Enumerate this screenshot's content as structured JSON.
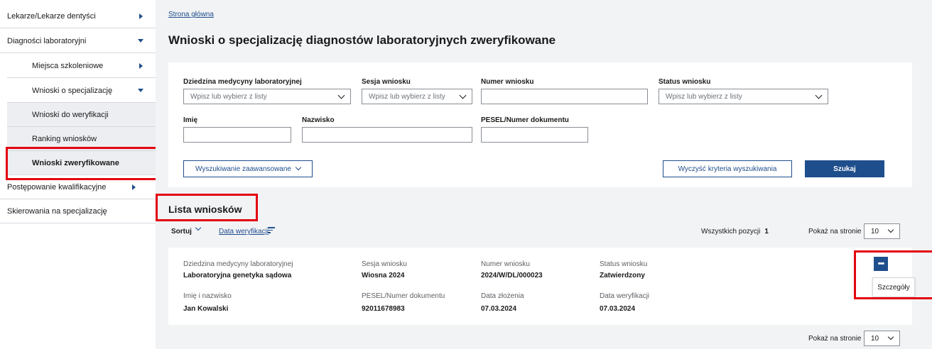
{
  "sidebar": {
    "items": [
      {
        "label": "Lekarze/Lekarze dentyści",
        "arrow": "right"
      },
      {
        "label": "Diagności laboratoryjni",
        "arrow": "down"
      },
      {
        "label": "Miejsca szkoleniowe",
        "arrow": "right"
      },
      {
        "label": "Wnioski o specjalizację",
        "arrow": "down"
      },
      {
        "label": "Wnioski do weryfikacji"
      },
      {
        "label": "Ranking wniosków"
      },
      {
        "label": "Wnioski zweryfikowane"
      },
      {
        "label": "Postępowanie kwalifikacyjne",
        "arrow": "right"
      },
      {
        "label": "Skierowania na specjalizację"
      }
    ]
  },
  "breadcrumb": "Strona główna",
  "page_title": "Wnioski o specjalizację diagnostów laboratoryjnych zweryfikowane",
  "filters": {
    "field": {
      "label": "Dziedzina medycyny laboratoryjnej",
      "placeholder": "Wpisz lub wybierz z listy"
    },
    "session": {
      "label": "Sesja wniosku",
      "placeholder": "Wpisz lub wybierz z listy"
    },
    "number": {
      "label": "Numer wniosku",
      "value": ""
    },
    "status": {
      "label": "Status wniosku",
      "placeholder": "Wpisz lub wybierz z listy"
    },
    "first_name": {
      "label": "Imię",
      "value": ""
    },
    "last_name": {
      "label": "Nazwisko",
      "value": ""
    },
    "pesel": {
      "label": "PESEL/Numer dokumentu",
      "value": ""
    },
    "advanced_label": "Wyszukiwanie zaawansowane",
    "clear_label": "Wyczyść kryteria wyszukiwania",
    "search_label": "Szukaj"
  },
  "list": {
    "title": "Lista wniosków",
    "sort_label": "Sortuj",
    "sort_by": "Data weryfikacji",
    "total_label": "Wszystkich pozycji",
    "total_value": "1",
    "per_page_label": "Pokaż na stronie",
    "per_page_value": "10",
    "items": [
      {
        "field_label": "Dziedzina medycyny laboratoryjnej",
        "field_value": "Laboratoryjna genetyka sądowa",
        "session_label": "Sesja wniosku",
        "session_value": "Wiosna 2024",
        "number_label": "Numer wniosku",
        "number_value": "2024/W/DL/000023",
        "status_label": "Status wniosku",
        "status_value": "Zatwierdzony",
        "name_label": "Imię i nazwisko",
        "name_value": "Jan Kowalski",
        "pesel_label": "PESEL/Numer dokumentu",
        "pesel_value": "92011678983",
        "submitted_label": "Data złożenia",
        "submitted_value": "07.03.2024",
        "verified_label": "Data weryfikacji",
        "verified_value": "07.03.2024",
        "more_label": "•••",
        "tooltip": "Szczegóły"
      }
    ]
  },
  "colors": {
    "primary": "#1f4e8c",
    "highlight": "#e3000f",
    "background": "#f2f3f5"
  }
}
